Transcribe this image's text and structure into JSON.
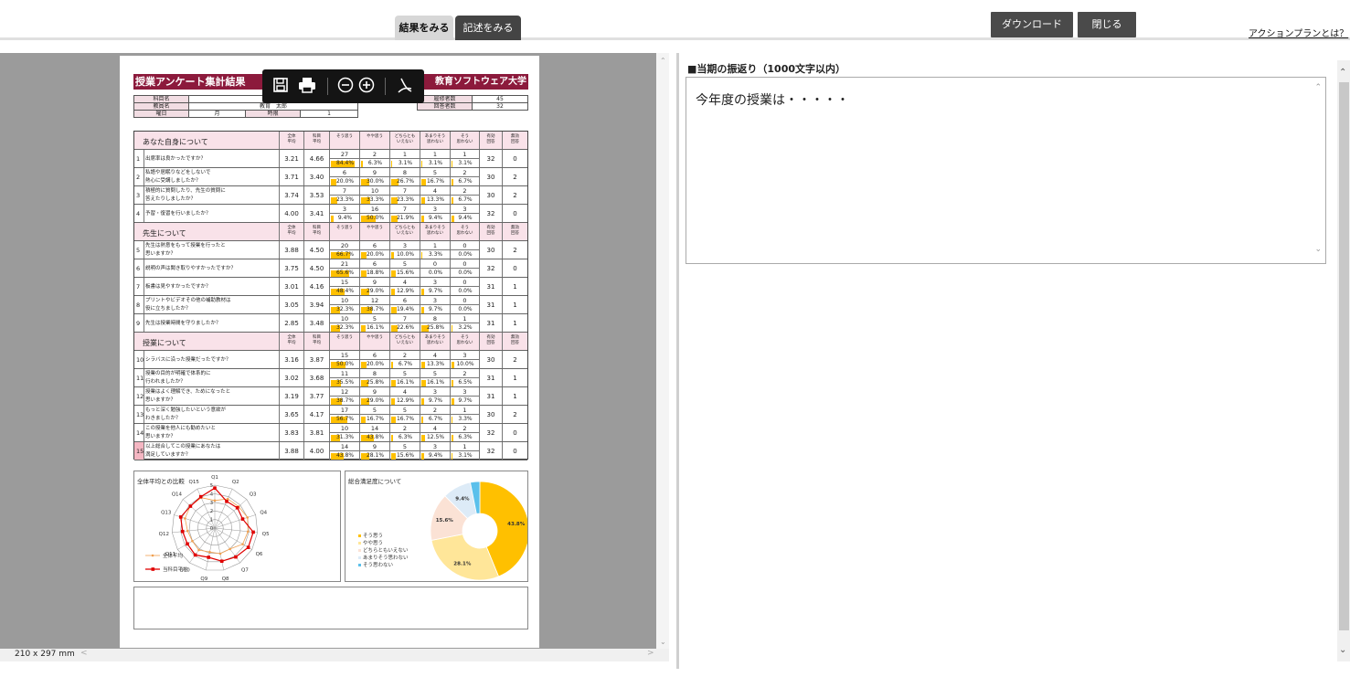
{
  "tabs": [
    {
      "label": "結果をみる"
    },
    {
      "label": "記述をみる"
    }
  ],
  "header_buttons": {
    "download": "ダウンロード",
    "close": "閉じる",
    "action_plan_link": "アクションプランとは？"
  },
  "viewer": {
    "page_size": "210 x 297 mm"
  },
  "toolbar_icons": [
    "save-icon",
    "print-icon",
    "zoom-out-icon",
    "zoom-in-icon",
    "pdf-icon"
  ],
  "report": {
    "title": "授業アンケート集計結果",
    "university": "教育ソフトウェア大学",
    "info": {
      "subject_label": "科目名",
      "subject_value": "",
      "teacher_label": "教員名",
      "teacher_value": "教育　太郎",
      "day_label": "曜日",
      "day_value": "月",
      "period_label": "時限",
      "period_value": "1",
      "enrolled_label": "履修者数",
      "enrolled_value": "45",
      "respondents_label": "回答者数",
      "respondents_value": "32"
    },
    "columns": [
      "全体\n平均",
      "科目\n平均",
      "そう思う",
      "やや思う",
      "どちらとも\nいえない",
      "あまりそう\n思わない",
      "そう\n思わない",
      "有効\n回答",
      "無効\n回答"
    ],
    "sections": [
      {
        "title": "あなた自身について",
        "questions": [
          {
            "no": "1",
            "text": "出席率は良かったですか？",
            "avg_all": "3.21",
            "avg_subj": "4.66",
            "counts": [
              "27",
              "2",
              "1",
              "1",
              "1"
            ],
            "pcts": [
              "84.4%",
              "6.3%",
              "3.1%",
              "3.1%",
              "3.1%"
            ],
            "pctv": [
              84.4,
              6.3,
              3.1,
              3.1,
              3.1
            ],
            "valid": "32",
            "invalid": "0"
          },
          {
            "no": "2",
            "text": "私語や居眠りなどをしないで\n熱心に受講しましたか？",
            "avg_all": "3.71",
            "avg_subj": "3.40",
            "counts": [
              "6",
              "9",
              "8",
              "5",
              "2"
            ],
            "pcts": [
              "20.0%",
              "30.0%",
              "26.7%",
              "16.7%",
              "6.7%"
            ],
            "pctv": [
              20,
              30,
              26.7,
              16.7,
              6.7
            ],
            "valid": "30",
            "invalid": "2"
          },
          {
            "no": "3",
            "text": "積極的に質問したり、先生の質問に\n答えたりしましたか？",
            "avg_all": "3.74",
            "avg_subj": "3.53",
            "counts": [
              "7",
              "10",
              "7",
              "4",
              "2"
            ],
            "pcts": [
              "23.3%",
              "33.3%",
              "23.3%",
              "13.3%",
              "6.7%"
            ],
            "pctv": [
              23.3,
              33.3,
              23.3,
              13.3,
              6.7
            ],
            "valid": "30",
            "invalid": "2"
          },
          {
            "no": "4",
            "text": "予習・復習を行いましたか？",
            "avg_all": "4.00",
            "avg_subj": "3.41",
            "counts": [
              "3",
              "16",
              "7",
              "3",
              "3"
            ],
            "pcts": [
              "9.4%",
              "50.0%",
              "21.9%",
              "9.4%",
              "9.4%"
            ],
            "pctv": [
              9.4,
              50,
              21.9,
              9.4,
              9.4
            ],
            "valid": "32",
            "invalid": "0"
          }
        ]
      },
      {
        "title": "先生について",
        "questions": [
          {
            "no": "5",
            "text": "先生は熱意をもって授業を行ったと\n思いますか？",
            "avg_all": "3.88",
            "avg_subj": "4.50",
            "counts": [
              "20",
              "6",
              "3",
              "1",
              "0"
            ],
            "pcts": [
              "66.7%",
              "20.0%",
              "10.0%",
              "3.3%",
              "0.0%"
            ],
            "pctv": [
              66.7,
              20,
              10,
              3.3,
              0
            ],
            "valid": "30",
            "invalid": "2"
          },
          {
            "no": "6",
            "text": "説明の声は聞き取りやすかったですか？",
            "avg_all": "3.75",
            "avg_subj": "4.50",
            "counts": [
              "21",
              "6",
              "5",
              "0",
              "0"
            ],
            "pcts": [
              "65.6%",
              "18.8%",
              "15.6%",
              "0.0%",
              "0.0%"
            ],
            "pctv": [
              65.6,
              18.8,
              15.6,
              0,
              0
            ],
            "valid": "32",
            "invalid": "0"
          },
          {
            "no": "7",
            "text": "板書は見やすかったですか？",
            "avg_all": "3.01",
            "avg_subj": "4.16",
            "counts": [
              "15",
              "9",
              "4",
              "3",
              "0"
            ],
            "pcts": [
              "48.4%",
              "29.0%",
              "12.9%",
              "9.7%",
              "0.0%"
            ],
            "pctv": [
              48.4,
              29,
              12.9,
              9.7,
              0
            ],
            "valid": "31",
            "invalid": "1"
          },
          {
            "no": "8",
            "text": "プリントやビデオその他の補助教材は\n役に立ちましたか？",
            "avg_all": "3.05",
            "avg_subj": "3.94",
            "counts": [
              "10",
              "12",
              "6",
              "3",
              "0"
            ],
            "pcts": [
              "32.3%",
              "38.7%",
              "19.4%",
              "9.7%",
              "0.0%"
            ],
            "pctv": [
              32.3,
              38.7,
              19.4,
              9.7,
              0
            ],
            "valid": "31",
            "invalid": "1"
          },
          {
            "no": "9",
            "text": "先生は授業時間を守りましたか？",
            "avg_all": "2.85",
            "avg_subj": "3.48",
            "counts": [
              "10",
              "5",
              "7",
              "8",
              "1"
            ],
            "pcts": [
              "32.3%",
              "16.1%",
              "22.6%",
              "25.8%",
              "3.2%"
            ],
            "pctv": [
              32.3,
              16.1,
              22.6,
              25.8,
              3.2
            ],
            "valid": "31",
            "invalid": "1"
          }
        ]
      },
      {
        "title": "授業について",
        "questions": [
          {
            "no": "10",
            "text": "シラバスに沿った授業だったですか？",
            "avg_all": "3.16",
            "avg_subj": "3.87",
            "counts": [
              "15",
              "6",
              "2",
              "4",
              "3"
            ],
            "pcts": [
              "50.0%",
              "20.0%",
              "6.7%",
              "13.3%",
              "10.0%"
            ],
            "pctv": [
              50,
              20,
              6.7,
              13.3,
              10
            ],
            "valid": "30",
            "invalid": "2"
          },
          {
            "no": "11",
            "text": "授業の目的が明確で体系的に\n行われましたか？",
            "avg_all": "3.02",
            "avg_subj": "3.68",
            "counts": [
              "11",
              "8",
              "5",
              "5",
              "2"
            ],
            "pcts": [
              "35.5%",
              "25.8%",
              "16.1%",
              "16.1%",
              "6.5%"
            ],
            "pctv": [
              35.5,
              25.8,
              16.1,
              16.1,
              6.5
            ],
            "valid": "31",
            "invalid": "1"
          },
          {
            "no": "12",
            "text": "授業はよく理解でき、ためになったと\n思いますか？",
            "avg_all": "3.19",
            "avg_subj": "3.77",
            "counts": [
              "12",
              "9",
              "4",
              "3",
              "3"
            ],
            "pcts": [
              "38.7%",
              "29.0%",
              "12.9%",
              "9.7%",
              "9.7%"
            ],
            "pctv": [
              38.7,
              29,
              12.9,
              9.7,
              9.7
            ],
            "valid": "31",
            "invalid": "1"
          },
          {
            "no": "13",
            "text": "もっと深く勉強したいという意欲が\nわきましたか？",
            "avg_all": "3.65",
            "avg_subj": "4.17",
            "counts": [
              "17",
              "5",
              "5",
              "2",
              "1"
            ],
            "pcts": [
              "56.7%",
              "16.7%",
              "16.7%",
              "6.7%",
              "3.3%"
            ],
            "pctv": [
              56.7,
              16.7,
              16.7,
              6.7,
              3.3
            ],
            "valid": "30",
            "invalid": "2"
          },
          {
            "no": "14",
            "text": "この授業を他人にも勧めたいと\n思いますか？",
            "avg_all": "3.83",
            "avg_subj": "3.81",
            "counts": [
              "10",
              "14",
              "2",
              "4",
              "2"
            ],
            "pcts": [
              "31.3%",
              "43.8%",
              "6.3%",
              "12.5%",
              "6.3%"
            ],
            "pctv": [
              31.3,
              43.8,
              6.3,
              12.5,
              6.3
            ],
            "valid": "32",
            "invalid": "0"
          },
          {
            "no": "15",
            "text": "以上総合してこの授業にあなたは\n満足していますか？",
            "avg_all": "3.88",
            "avg_subj": "4.00",
            "counts": [
              "14",
              "9",
              "5",
              "3",
              "1"
            ],
            "pcts": [
              "43.8%",
              "28.1%",
              "15.6%",
              "9.4%",
              "3.1%"
            ],
            "pctv": [
              43.8,
              28.1,
              15.6,
              9.4,
              3.1
            ],
            "valid": "32",
            "invalid": "0"
          }
        ]
      }
    ]
  },
  "chart_data": [
    {
      "type": "radar",
      "title": "全体平均との比較",
      "categories": [
        "Q1",
        "Q2",
        "Q3",
        "Q4",
        "Q5",
        "Q6",
        "Q7",
        "Q8",
        "Q9",
        "Q10",
        "Q11",
        "Q12",
        "Q13",
        "Q14",
        "Q15"
      ],
      "tick_labels": [
        "0",
        "1",
        "2",
        "3",
        "4",
        "5"
      ],
      "range": [
        0,
        5
      ],
      "series": [
        {
          "name": "全体平均",
          "color": "#f0a050",
          "values": [
            3.21,
            3.71,
            3.74,
            4.0,
            3.88,
            3.75,
            3.01,
            3.05,
            2.85,
            3.16,
            3.02,
            3.19,
            3.65,
            3.83,
            3.88
          ]
        },
        {
          "name": "当科目平均",
          "color": "#e00000",
          "values": [
            4.66,
            3.4,
            3.53,
            3.41,
            4.5,
            4.5,
            4.16,
            3.94,
            3.48,
            3.87,
            3.68,
            3.77,
            4.17,
            3.81,
            4.0
          ]
        }
      ]
    },
    {
      "type": "pie",
      "title": "総合満足度について",
      "categories": [
        "そう思う",
        "やや思う",
        "どちらともいえない",
        "あまりそう思わない",
        "そう思わない"
      ],
      "values": [
        43.8,
        28.1,
        15.6,
        9.4,
        3.1
      ],
      "labels": [
        "43.8%",
        "28.1%",
        "15.6%",
        "9.4%",
        ""
      ],
      "colors": [
        "#ffc000",
        "#ffe699",
        "#fbe2d5",
        "#ddebf7",
        "#5bc0eb"
      ]
    }
  ],
  "right_panel": {
    "title": "■当期の振返り（1000文字以内）",
    "text": "今年度の授業は・・・・・"
  }
}
